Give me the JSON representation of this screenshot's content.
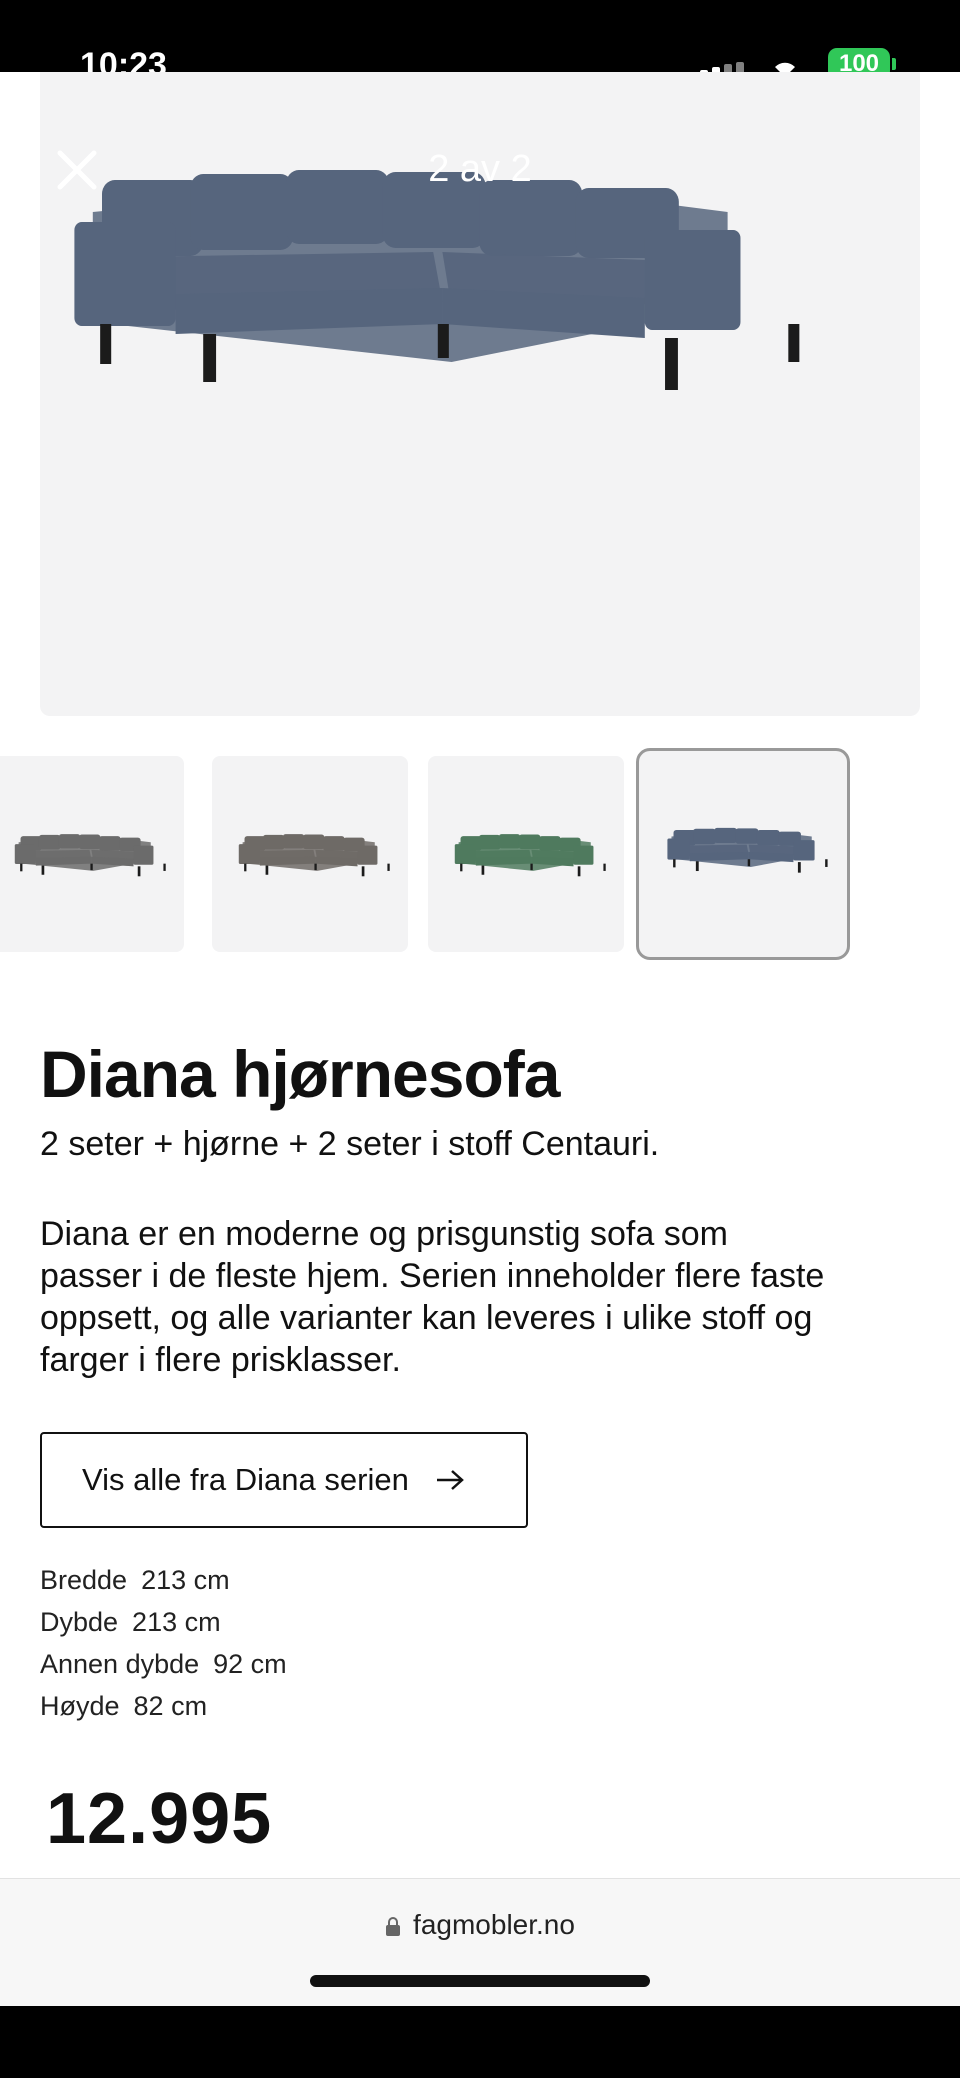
{
  "status_bar": {
    "time": "10:23",
    "battery": "100"
  },
  "gallery": {
    "counter": "2 av 2",
    "thumbnails": [
      {
        "color_name": "grey",
        "color": "#6b6b6b"
      },
      {
        "color_name": "grey-brown",
        "color": "#6e6a66"
      },
      {
        "color_name": "green",
        "color": "#4f7a5e"
      },
      {
        "color_name": "blue",
        "color": "#56657d"
      }
    ],
    "active_index": 3,
    "hero_color": "#56657d"
  },
  "product": {
    "title": "Diana hjørnesofa",
    "subtitle": "2 seter + hjørne + 2 seter i stoff Centauri.",
    "description_lines": [
      "Diana er en moderne og prisgunstig sofa som",
      "passer i de fleste hjem. Serien inneholder flere faste",
      "oppsett, og alle varianter kan leveres i ulike stoff og",
      "farger i flere prisklasser."
    ],
    "series_button": "Vis alle fra Diana serien",
    "specs": [
      {
        "label": "Bredde",
        "value": "213 cm"
      },
      {
        "label": "Dybde",
        "value": "213 cm"
      },
      {
        "label": "Annen dybde",
        "value": "92 cm"
      },
      {
        "label": "Høyde",
        "value": "82 cm"
      }
    ],
    "price": "12.995"
  },
  "browser": {
    "url": "fagmobler.no"
  }
}
